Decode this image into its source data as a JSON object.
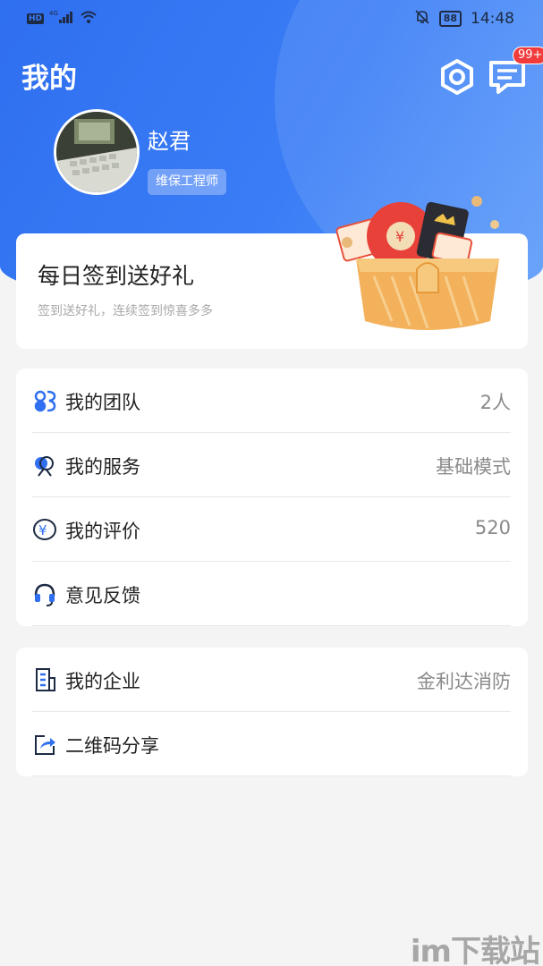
{
  "status_bar": {
    "network": "4G",
    "battery": "88",
    "time": "14:48"
  },
  "header": {
    "title": "我的",
    "notification_count": "99+"
  },
  "profile": {
    "name": "赵君",
    "role": "维保工程师"
  },
  "checkin": {
    "title": "每日签到送好礼",
    "subtitle": "签到送好礼，连续签到惊喜多多"
  },
  "menu_group_1": [
    {
      "label": "我的团队",
      "value": "2人",
      "icon": "team-icon"
    },
    {
      "label": "我的服务",
      "value": "基础模式",
      "icon": "service-icon"
    },
    {
      "label": "我的评价",
      "value": "520",
      "icon": "rating-icon"
    },
    {
      "label": "意见反馈",
      "value": "",
      "icon": "headset-icon"
    }
  ],
  "menu_group_2": [
    {
      "label": "我的企业",
      "value": "金利达消防",
      "icon": "building-icon"
    },
    {
      "label": "二维码分享",
      "value": "",
      "icon": "share-icon"
    }
  ],
  "watermark": "im下载站",
  "colors": {
    "primary": "#3a7df6",
    "badge": "#f23b3b",
    "background": "#f4f4f4"
  }
}
